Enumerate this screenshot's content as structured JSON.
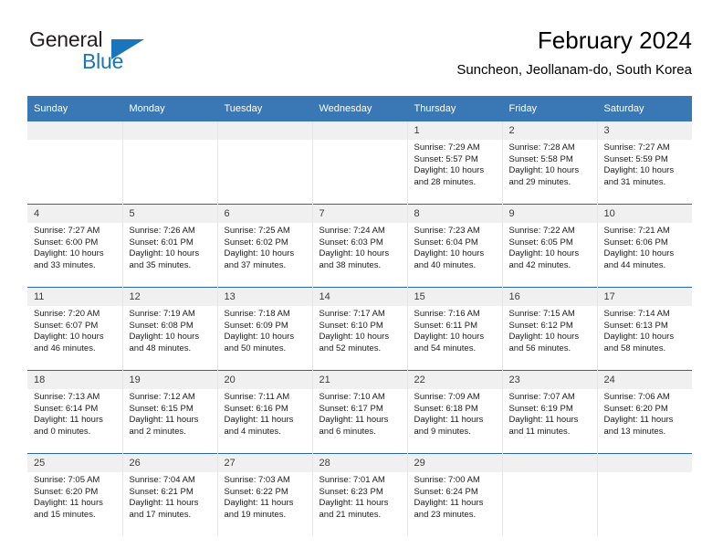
{
  "brand": {
    "name_part1": "General",
    "name_part2": "Blue",
    "logo_icon": "triangle-icon"
  },
  "header": {
    "title": "February 2024",
    "subtitle": "Suncheon, Jeollanam-do, South Korea"
  },
  "colors": {
    "header_blue": "#3a78b5",
    "row_divider_blue": "#2b66a8",
    "daynum_band": "#f0f0f0",
    "brand_blue": "#1b75bb"
  },
  "weekday_headers": [
    "Sunday",
    "Monday",
    "Tuesday",
    "Wednesday",
    "Thursday",
    "Friday",
    "Saturday"
  ],
  "weeks": [
    [
      {
        "day": "",
        "sunrise": "",
        "sunset": "",
        "daylight_line1": "",
        "daylight_line2": ""
      },
      {
        "day": "",
        "sunrise": "",
        "sunset": "",
        "daylight_line1": "",
        "daylight_line2": ""
      },
      {
        "day": "",
        "sunrise": "",
        "sunset": "",
        "daylight_line1": "",
        "daylight_line2": ""
      },
      {
        "day": "",
        "sunrise": "",
        "sunset": "",
        "daylight_line1": "",
        "daylight_line2": ""
      },
      {
        "day": "1",
        "sunrise": "Sunrise: 7:29 AM",
        "sunset": "Sunset: 5:57 PM",
        "daylight_line1": "Daylight: 10 hours",
        "daylight_line2": "and 28 minutes."
      },
      {
        "day": "2",
        "sunrise": "Sunrise: 7:28 AM",
        "sunset": "Sunset: 5:58 PM",
        "daylight_line1": "Daylight: 10 hours",
        "daylight_line2": "and 29 minutes."
      },
      {
        "day": "3",
        "sunrise": "Sunrise: 7:27 AM",
        "sunset": "Sunset: 5:59 PM",
        "daylight_line1": "Daylight: 10 hours",
        "daylight_line2": "and 31 minutes."
      }
    ],
    [
      {
        "day": "4",
        "sunrise": "Sunrise: 7:27 AM",
        "sunset": "Sunset: 6:00 PM",
        "daylight_line1": "Daylight: 10 hours",
        "daylight_line2": "and 33 minutes."
      },
      {
        "day": "5",
        "sunrise": "Sunrise: 7:26 AM",
        "sunset": "Sunset: 6:01 PM",
        "daylight_line1": "Daylight: 10 hours",
        "daylight_line2": "and 35 minutes."
      },
      {
        "day": "6",
        "sunrise": "Sunrise: 7:25 AM",
        "sunset": "Sunset: 6:02 PM",
        "daylight_line1": "Daylight: 10 hours",
        "daylight_line2": "and 37 minutes."
      },
      {
        "day": "7",
        "sunrise": "Sunrise: 7:24 AM",
        "sunset": "Sunset: 6:03 PM",
        "daylight_line1": "Daylight: 10 hours",
        "daylight_line2": "and 38 minutes."
      },
      {
        "day": "8",
        "sunrise": "Sunrise: 7:23 AM",
        "sunset": "Sunset: 6:04 PM",
        "daylight_line1": "Daylight: 10 hours",
        "daylight_line2": "and 40 minutes."
      },
      {
        "day": "9",
        "sunrise": "Sunrise: 7:22 AM",
        "sunset": "Sunset: 6:05 PM",
        "daylight_line1": "Daylight: 10 hours",
        "daylight_line2": "and 42 minutes."
      },
      {
        "day": "10",
        "sunrise": "Sunrise: 7:21 AM",
        "sunset": "Sunset: 6:06 PM",
        "daylight_line1": "Daylight: 10 hours",
        "daylight_line2": "and 44 minutes."
      }
    ],
    [
      {
        "day": "11",
        "sunrise": "Sunrise: 7:20 AM",
        "sunset": "Sunset: 6:07 PM",
        "daylight_line1": "Daylight: 10 hours",
        "daylight_line2": "and 46 minutes."
      },
      {
        "day": "12",
        "sunrise": "Sunrise: 7:19 AM",
        "sunset": "Sunset: 6:08 PM",
        "daylight_line1": "Daylight: 10 hours",
        "daylight_line2": "and 48 minutes."
      },
      {
        "day": "13",
        "sunrise": "Sunrise: 7:18 AM",
        "sunset": "Sunset: 6:09 PM",
        "daylight_line1": "Daylight: 10 hours",
        "daylight_line2": "and 50 minutes."
      },
      {
        "day": "14",
        "sunrise": "Sunrise: 7:17 AM",
        "sunset": "Sunset: 6:10 PM",
        "daylight_line1": "Daylight: 10 hours",
        "daylight_line2": "and 52 minutes."
      },
      {
        "day": "15",
        "sunrise": "Sunrise: 7:16 AM",
        "sunset": "Sunset: 6:11 PM",
        "daylight_line1": "Daylight: 10 hours",
        "daylight_line2": "and 54 minutes."
      },
      {
        "day": "16",
        "sunrise": "Sunrise: 7:15 AM",
        "sunset": "Sunset: 6:12 PM",
        "daylight_line1": "Daylight: 10 hours",
        "daylight_line2": "and 56 minutes."
      },
      {
        "day": "17",
        "sunrise": "Sunrise: 7:14 AM",
        "sunset": "Sunset: 6:13 PM",
        "daylight_line1": "Daylight: 10 hours",
        "daylight_line2": "and 58 minutes."
      }
    ],
    [
      {
        "day": "18",
        "sunrise": "Sunrise: 7:13 AM",
        "sunset": "Sunset: 6:14 PM",
        "daylight_line1": "Daylight: 11 hours",
        "daylight_line2": "and 0 minutes."
      },
      {
        "day": "19",
        "sunrise": "Sunrise: 7:12 AM",
        "sunset": "Sunset: 6:15 PM",
        "daylight_line1": "Daylight: 11 hours",
        "daylight_line2": "and 2 minutes."
      },
      {
        "day": "20",
        "sunrise": "Sunrise: 7:11 AM",
        "sunset": "Sunset: 6:16 PM",
        "daylight_line1": "Daylight: 11 hours",
        "daylight_line2": "and 4 minutes."
      },
      {
        "day": "21",
        "sunrise": "Sunrise: 7:10 AM",
        "sunset": "Sunset: 6:17 PM",
        "daylight_line1": "Daylight: 11 hours",
        "daylight_line2": "and 6 minutes."
      },
      {
        "day": "22",
        "sunrise": "Sunrise: 7:09 AM",
        "sunset": "Sunset: 6:18 PM",
        "daylight_line1": "Daylight: 11 hours",
        "daylight_line2": "and 9 minutes."
      },
      {
        "day": "23",
        "sunrise": "Sunrise: 7:07 AM",
        "sunset": "Sunset: 6:19 PM",
        "daylight_line1": "Daylight: 11 hours",
        "daylight_line2": "and 11 minutes."
      },
      {
        "day": "24",
        "sunrise": "Sunrise: 7:06 AM",
        "sunset": "Sunset: 6:20 PM",
        "daylight_line1": "Daylight: 11 hours",
        "daylight_line2": "and 13 minutes."
      }
    ],
    [
      {
        "day": "25",
        "sunrise": "Sunrise: 7:05 AM",
        "sunset": "Sunset: 6:20 PM",
        "daylight_line1": "Daylight: 11 hours",
        "daylight_line2": "and 15 minutes."
      },
      {
        "day": "26",
        "sunrise": "Sunrise: 7:04 AM",
        "sunset": "Sunset: 6:21 PM",
        "daylight_line1": "Daylight: 11 hours",
        "daylight_line2": "and 17 minutes."
      },
      {
        "day": "27",
        "sunrise": "Sunrise: 7:03 AM",
        "sunset": "Sunset: 6:22 PM",
        "daylight_line1": "Daylight: 11 hours",
        "daylight_line2": "and 19 minutes."
      },
      {
        "day": "28",
        "sunrise": "Sunrise: 7:01 AM",
        "sunset": "Sunset: 6:23 PM",
        "daylight_line1": "Daylight: 11 hours",
        "daylight_line2": "and 21 minutes."
      },
      {
        "day": "29",
        "sunrise": "Sunrise: 7:00 AM",
        "sunset": "Sunset: 6:24 PM",
        "daylight_line1": "Daylight: 11 hours",
        "daylight_line2": "and 23 minutes."
      },
      {
        "day": "",
        "sunrise": "",
        "sunset": "",
        "daylight_line1": "",
        "daylight_line2": ""
      },
      {
        "day": "",
        "sunrise": "",
        "sunset": "",
        "daylight_line1": "",
        "daylight_line2": ""
      }
    ]
  ]
}
